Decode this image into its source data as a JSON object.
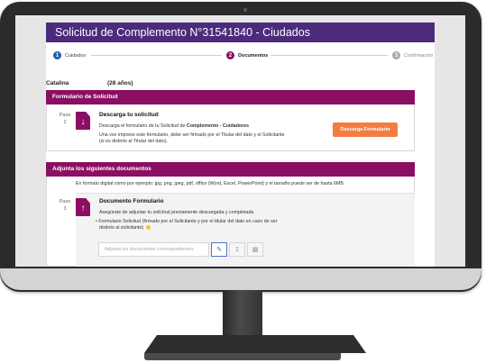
{
  "page": {
    "title": "Solicitud de Complemento N°31541840 - Ciudados"
  },
  "stepper": {
    "steps": [
      {
        "number": "1",
        "label": "Cuidados",
        "state": "done"
      },
      {
        "number": "2",
        "label": "Documentos",
        "state": "active"
      },
      {
        "number": "3",
        "label": "Confirmación",
        "state": "pending"
      }
    ]
  },
  "person": {
    "name": "Catalina",
    "age": "(28 años)"
  },
  "formulario": {
    "header": "Formulario de Solicitud",
    "paso_label": "Paso",
    "paso_number": "2",
    "title": "Descarga tu solicitud",
    "line1_prefix": "Descarga el formulario de tu Solicitud de ",
    "line1_bold": "Complemento - Cuidadores",
    "line2": "Una vez impreso este formulario, debe ser firmado por el Titular del dato y el Solicitante",
    "line3": "(si es distinto al Titular del dato).",
    "button_label": "Descarga Formulario"
  },
  "adjunta": {
    "header": "Adjunta los siguientes documentos",
    "info": "En formato digital como por ejemplo: jpg, png, jpeg, pdf, office (Word, Excel, PowerPoint) y el tamaño puede ser de hasta 6MB",
    "paso_label": "Paso",
    "paso_number": "3",
    "title": "Documento Formulario",
    "instruction": "Asegúrate de adjuntar tu solicitud previamente descargada y completada",
    "bullet_line1": "• Formulario Solicitud (firmado por el Solicitante y por el titular del dato en caso de ser",
    "bullet_line2": "distinto al solicitante)",
    "upload_placeholder": "Adjunta los documentos correspondientes"
  },
  "icons": {
    "download": "download-icon",
    "upload": "upload-icon",
    "attach": "paperclip-icon",
    "trash": "trash-icon"
  },
  "colors": {
    "title_bar": "#4c2a7c",
    "section_header": "#8a0f62",
    "step_done": "#1f5fa8",
    "step_active": "#8a0f62",
    "step_pending": "#a8a8a8",
    "button": "#f47c42"
  }
}
